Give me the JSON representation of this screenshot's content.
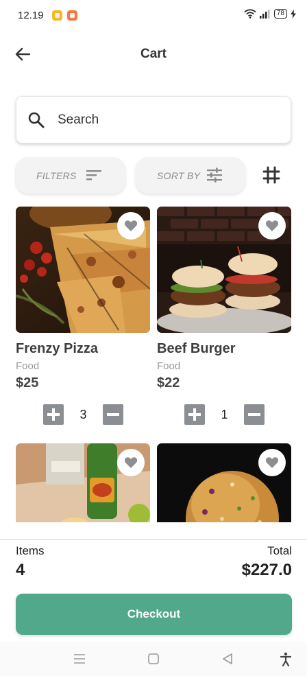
{
  "status_bar": {
    "time": "12.19",
    "battery": "78"
  },
  "header": {
    "title": "Cart"
  },
  "search": {
    "placeholder": "Search"
  },
  "filters": {
    "filters_label": "FILTERS",
    "sort_label": "SORT BY"
  },
  "products": [
    {
      "name": "Frenzy Pizza",
      "category": "Food",
      "price": "$25",
      "quantity": "3"
    },
    {
      "name": "Beef Burger",
      "category": "Food",
      "price": "$22",
      "quantity": "1"
    }
  ],
  "summary": {
    "items_label": "Items",
    "items_value": "4",
    "total_label": "Total",
    "total_value": "$227.0"
  },
  "checkout_label": "Checkout",
  "colors": {
    "accent": "#52a88a",
    "qty_button": "#8b8f93",
    "text_dark": "#333333",
    "text_muted": "#999999"
  }
}
